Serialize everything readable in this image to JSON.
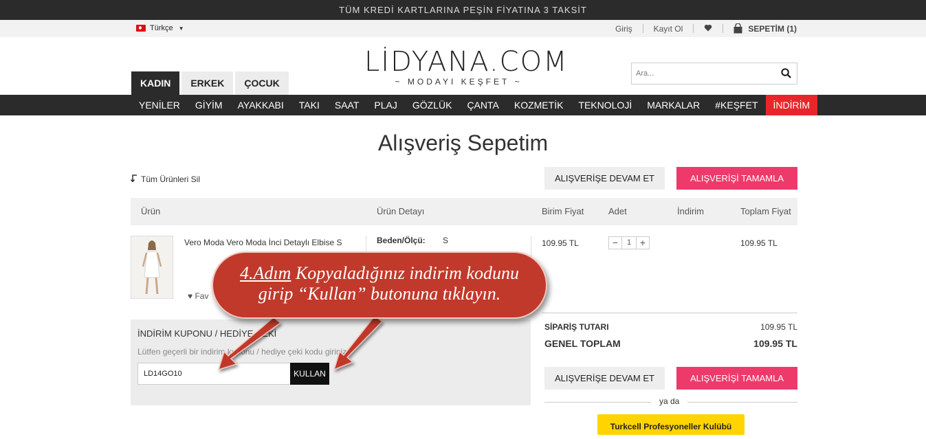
{
  "promo_bar": "TÜM KREDİ KARTLARINA PEŞİN FİYATINA 3 TAKSİT",
  "util": {
    "language": "Türkçe",
    "login": "Giriş",
    "register": "Kayıt Ol",
    "cart_label": "SEPETİM (1)"
  },
  "logo": {
    "name": "LİDYANA.COM",
    "tagline": "~ MODAYI KEŞFET ~"
  },
  "gender_tabs": [
    "KADIN",
    "ERKEK",
    "ÇOCUK"
  ],
  "search": {
    "placeholder": "Ara..."
  },
  "nav": [
    "YENİLER",
    "GİYİM",
    "AYAKKABI",
    "TAKI",
    "SAAT",
    "PLAJ",
    "GÖZLÜK",
    "ÇANTA",
    "KOZMETİK",
    "TEKNOLOJİ",
    "MARKALAR",
    "#KEŞFET",
    "İNDİRİM"
  ],
  "page_title": "Alışveriş Sepetim",
  "clear_all": "Tüm Ürünleri Sil",
  "buttons": {
    "continue": "ALIŞVERİŞE DEVAM ET",
    "checkout": "ALIŞVERİŞİ TAMAMLA"
  },
  "table_headers": {
    "product": "Ürün",
    "detail": "Ürün Detayı",
    "unit_price": "Birim Fiyat",
    "qty": "Adet",
    "discount": "İndirim",
    "total": "Toplam Fiyat"
  },
  "item": {
    "name": "Vero Moda Vero Moda İnci Detaylı Elbise S",
    "size_label": "Beden/Ölçü:",
    "size_value": "S",
    "unit_price": "109.95 TL",
    "quantity": "1",
    "total": "109.95 TL",
    "favorite": "Fav"
  },
  "coupon": {
    "title": "İNDİRİM KUPONU / HEDİYE ÇEKİ",
    "hint": "Lütfen geçerli bir indirim kuponu / hediye çeki kodu giriniz",
    "value": "LD14GO10",
    "use_button": "KULLAN"
  },
  "summary": {
    "order_label": "SİPARİŞ TUTARI",
    "order_value": "109.95 TL",
    "grand_label": "GENEL TOPLAM",
    "grand_value": "109.95 TL"
  },
  "or_text": "ya da",
  "turkcell": "Turkcell Profesyoneller Kulübü",
  "callout": {
    "step": "4.Adım",
    "line1_rest": " Kopyaladığınız indirim kodunu",
    "line2": "girip “Kullan” butonuna tıklayın."
  },
  "colors": {
    "accent_pink": "#ee3a6b",
    "sale_red": "#e8262a",
    "callout_red": "#c0392b",
    "dark": "#2b2b2b"
  }
}
